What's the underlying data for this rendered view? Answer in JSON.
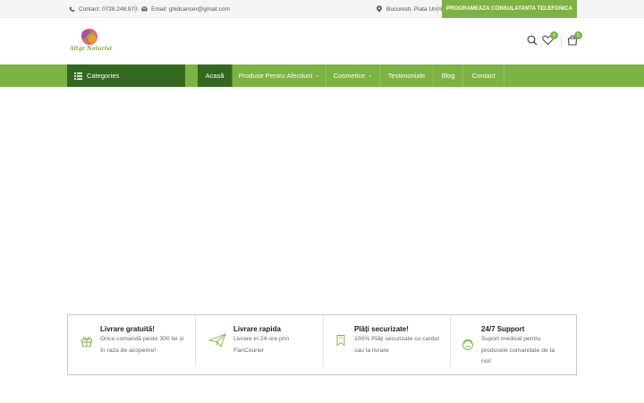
{
  "topbar": {
    "phone": "Contact: 0728.248.978",
    "email": "Email: ghidcancer@gmail.com",
    "location": "Bucuresti, Piata Unirii",
    "cta_button": "PROGRAMEAZA CONSULATANTA TELEFONICA"
  },
  "header": {
    "logo_text": "Altgr Naturist",
    "wishlist_count": "0",
    "cart_count": "0"
  },
  "nav": {
    "categories_label": "Categories",
    "items": [
      {
        "label": "Acasă"
      },
      {
        "label": "Produse Pentru Afectiuni"
      },
      {
        "label": "Cosmetice"
      },
      {
        "label": "Testimoniale"
      },
      {
        "label": "Blog"
      },
      {
        "label": "Contact"
      }
    ]
  },
  "features": [
    {
      "icon": "gift-icon",
      "title": "Livrare gratuită!",
      "desc": "Orice comandă peste 300 lei și în raza de acoperire!"
    },
    {
      "icon": "paper-plane-icon",
      "title": "Livrare rapida",
      "desc": "Livrare in 24 ore prin FanCourier"
    },
    {
      "icon": "bookmark-icon",
      "title": "Plăți securizate!",
      "desc": "100% Plăți securizate cu cardul sau la livrare"
    },
    {
      "icon": "support-icon",
      "title": "24/7 Support",
      "desc": "Suport medical pentru produsele comandate de la noi!"
    }
  ],
  "colors": {
    "brand_green": "#7cb342",
    "dark_green": "#33691e"
  }
}
